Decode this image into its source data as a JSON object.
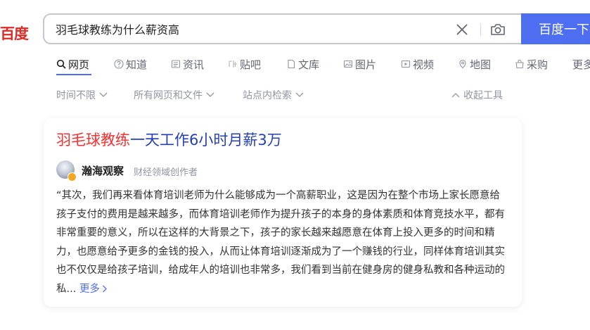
{
  "header": {
    "logo_text": "百度",
    "search_value": "羽毛球教练为什么薪资高",
    "search_button": "百度一下"
  },
  "tabs": [
    {
      "label": "网页",
      "icon": "search-icon",
      "active": true
    },
    {
      "label": "知道",
      "icon": "question-icon"
    },
    {
      "label": "资讯",
      "icon": "news-icon"
    },
    {
      "label": "贴吧",
      "icon": "tieba-icon"
    },
    {
      "label": "文库",
      "icon": "document-icon"
    },
    {
      "label": "图片",
      "icon": "image-icon"
    },
    {
      "label": "视频",
      "icon": "video-icon"
    },
    {
      "label": "地图",
      "icon": "map-icon"
    },
    {
      "label": "采购",
      "icon": "shopping-icon"
    },
    {
      "label": "更多"
    }
  ],
  "filters": {
    "time": "时间不限",
    "file_type": "所有网页和文件",
    "site": "站点内检索",
    "collapse": "收起工具"
  },
  "result": {
    "title_highlight": "羽毛球教练",
    "title_rest": "一天工作6小时月薪3万",
    "author": "瀚海观察",
    "author_desc": "财经领域创作者",
    "snippet": "“其次，我们再来看体育培训老师为什么能够成为一个高薪职业，这是因为在整个市场上家长愿意给孩子支付的费用是越来越多，而体育培训老师作为提升孩子的本身的身体素质和体育竞技水平，都有非常重要的意义，所以在这样的大背景之下，孩子的家长越来越愿意在体育上投入更多的时间和精力，也愿意给予更多的金钱的投入，从而让体育培训逐渐成为了一个赚钱的行业，同样体育培训其实也不仅仅是给孩子培训，给成年人的培训也非常多，我们看到当前在健身房的健身私教和各种运动的私...",
    "more": "更多"
  },
  "colors": {
    "brand": "#4e6ef2",
    "logo": "#de2c25",
    "highlight": "#f73131",
    "link": "#2440b3"
  }
}
